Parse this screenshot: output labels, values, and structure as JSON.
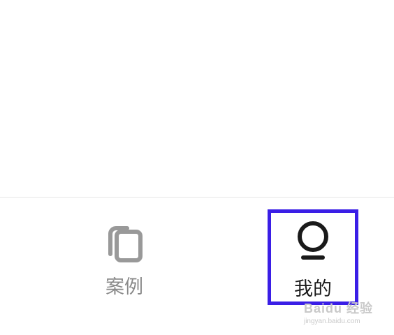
{
  "tabbar": {
    "tabs": [
      {
        "label": "案例",
        "icon": "cases-icon",
        "active": false
      },
      {
        "label": "我的",
        "icon": "profile-icon",
        "active": true
      }
    ]
  },
  "colors": {
    "inactive": "#8a8a8a",
    "active": "#1a1a1a",
    "highlight": "#3a1ee6"
  },
  "watermark": {
    "title": "Baidu 经验",
    "url": "jingyan.baidu.com"
  }
}
